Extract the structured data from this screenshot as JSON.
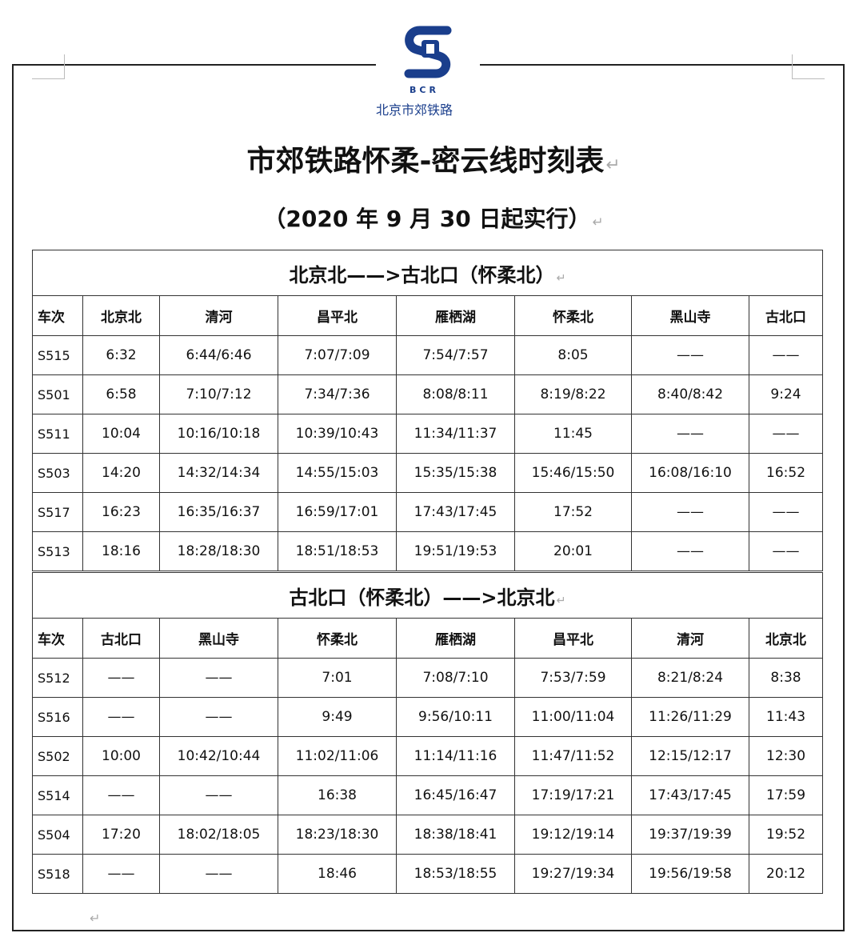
{
  "logo": {
    "text": "BCR",
    "org": "北京市郊铁路",
    "color": "#1a3e8c"
  },
  "title": "市郊铁路怀柔-密云线时刻表",
  "subtitle": "（2020 年 9 月 30 日起实行）",
  "sections": [
    {
      "heading": "北京北——>古北口（怀柔北）",
      "columns": [
        "车次",
        "北京北",
        "清河",
        "昌平北",
        "雁栖湖",
        "怀柔北",
        "黑山寺",
        "古北口"
      ],
      "rows": [
        [
          "S515",
          "6:32",
          "6:44/6:46",
          "7:07/7:09",
          "7:54/7:57",
          "8:05",
          "——",
          "——"
        ],
        [
          "S501",
          "6:58",
          "7:10/7:12",
          "7:34/7:36",
          "8:08/8:11",
          "8:19/8:22",
          "8:40/8:42",
          "9:24"
        ],
        [
          "S511",
          "10:04",
          "10:16/10:18",
          "10:39/10:43",
          "11:34/11:37",
          "11:45",
          "——",
          "——"
        ],
        [
          "S503",
          "14:20",
          "14:32/14:34",
          "14:55/15:03",
          "15:35/15:38",
          "15:46/15:50",
          "16:08/16:10",
          "16:52"
        ],
        [
          "S517",
          "16:23",
          "16:35/16:37",
          "16:59/17:01",
          "17:43/17:45",
          "17:52",
          "——",
          "——"
        ],
        [
          "S513",
          "18:16",
          "18:28/18:30",
          "18:51/18:53",
          "19:51/19:53",
          "20:01",
          "——",
          "——"
        ]
      ]
    },
    {
      "heading": "古北口（怀柔北）——>北京北",
      "columns": [
        "车次",
        "古北口",
        "黑山寺",
        "怀柔北",
        "雁栖湖",
        "昌平北",
        "清河",
        "北京北"
      ],
      "rows": [
        [
          "S512",
          "——",
          "——",
          "7:01",
          "7:08/7:10",
          "7:53/7:59",
          "8:21/8:24",
          "8:38"
        ],
        [
          "S516",
          "——",
          "——",
          "9:49",
          "9:56/10:11",
          "11:00/11:04",
          "11:26/11:29",
          "11:43"
        ],
        [
          "S502",
          "10:00",
          "10:42/10:44",
          "11:02/11:06",
          "11:14/11:16",
          "11:47/11:52",
          "12:15/12:17",
          "12:30"
        ],
        [
          "S514",
          "——",
          "——",
          "16:38",
          "16:45/16:47",
          "17:19/17:21",
          "17:43/17:45",
          "17:59"
        ],
        [
          "S504",
          "17:20",
          "18:02/18:05",
          "18:23/18:30",
          "18:38/18:41",
          "19:12/19:14",
          "19:37/19:39",
          "19:52"
        ],
        [
          "S518",
          "——",
          "——",
          "18:46",
          "18:53/18:55",
          "19:27/19:34",
          "19:56/19:58",
          "20:12"
        ]
      ]
    }
  ]
}
